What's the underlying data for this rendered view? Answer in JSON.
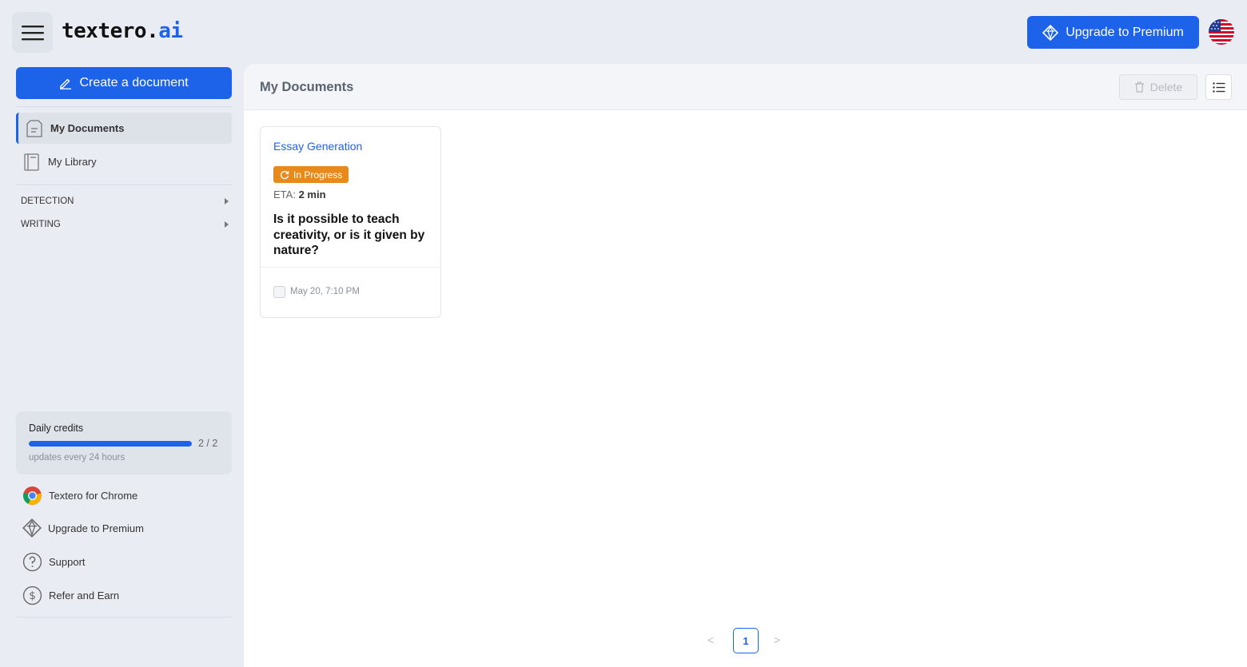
{
  "header": {
    "logo_text": "textero.",
    "logo_accent": "ai",
    "upgrade_label": "Upgrade to Premium",
    "language_flag": "us-flag-icon"
  },
  "sidebar": {
    "create_label": "Create a document",
    "nav": [
      {
        "label": "My Documents",
        "icon": "document-icon",
        "active": true
      },
      {
        "label": "My Library",
        "icon": "library-icon",
        "active": false
      }
    ],
    "sections": [
      {
        "label": "DETECTION"
      },
      {
        "label": "WRITING"
      }
    ],
    "credits": {
      "title": "Daily credits",
      "count": "2 / 2",
      "used_fraction": 1.0,
      "subtitle": "updates every 24 hours"
    },
    "bottom": [
      {
        "label": "Textero for Chrome",
        "icon": "chrome-icon"
      },
      {
        "label": "Upgrade to Premium",
        "icon": "diamond-icon"
      },
      {
        "label": "Support",
        "icon": "question-icon"
      },
      {
        "label": "Refer and Earn",
        "icon": "dollar-icon"
      }
    ]
  },
  "main": {
    "title": "My Documents",
    "delete_label": "Delete",
    "documents": [
      {
        "type": "Essay Generation",
        "status": "In Progress",
        "eta_label": "ETA:",
        "eta_value": "2 min",
        "title": "Is it possible to teach creativity, or is it given by nature?",
        "date": "May 20, 7:10 PM"
      }
    ],
    "pagination": {
      "prev": "<",
      "current": "1",
      "next": ">"
    }
  },
  "colors": {
    "accent": "#1d63ea",
    "status_in_progress": "#e8891c",
    "background": "#e9edf3"
  }
}
